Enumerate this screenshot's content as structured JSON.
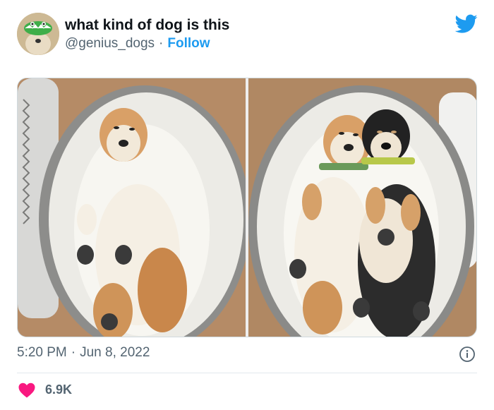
{
  "tweet": {
    "display_name": "what kind of dog is this",
    "handle": "@genius_dogs",
    "separator": "·",
    "follow_label": "Follow",
    "time": "5:20 PM",
    "date": "Jun 8, 2022",
    "like_count": "6.9K"
  },
  "colors": {
    "accent": "#1d9bf0",
    "like": "#f91880",
    "muted": "#536471",
    "text": "#0f1419"
  },
  "icons": {
    "brand": "twitter-bird-icon",
    "info": "info-icon",
    "like": "heart-icon"
  }
}
